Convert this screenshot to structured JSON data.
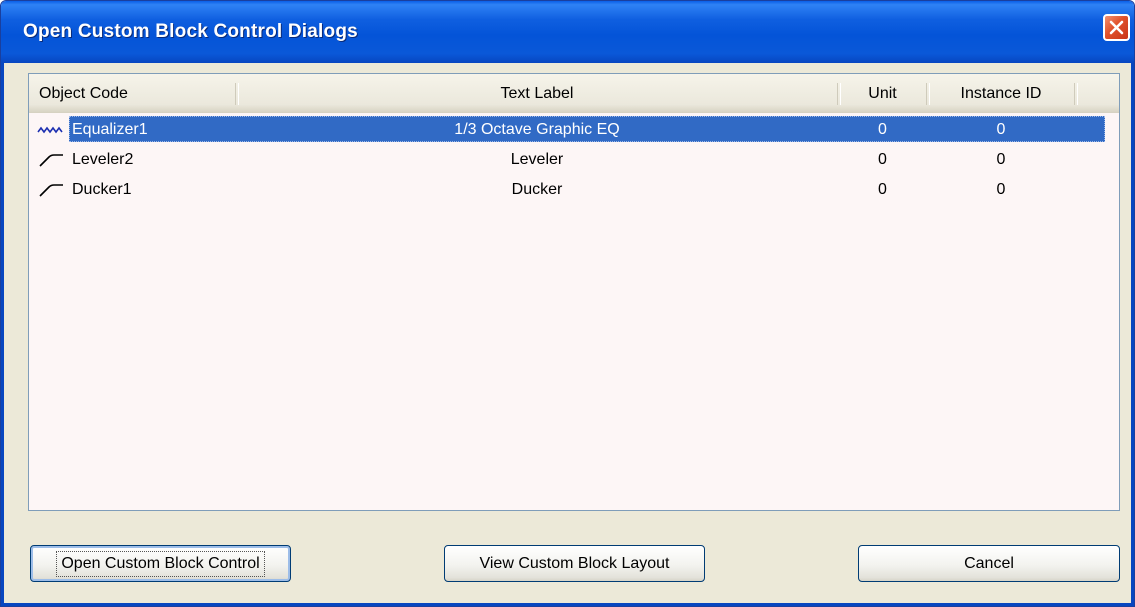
{
  "window": {
    "title": "Open Custom Block Control Dialogs",
    "close_icon": "close-x-icon"
  },
  "list": {
    "columns": [
      "Object Code",
      "Text Label",
      "Unit",
      "Instance ID"
    ],
    "rows": [
      {
        "icon": "wave-icon",
        "object_code": "Equalizer1",
        "text_label": "1/3 Octave Graphic EQ",
        "unit": "0",
        "instance_id": "0",
        "selected": true
      },
      {
        "icon": "ramp-icon",
        "object_code": "Leveler2",
        "text_label": "Leveler",
        "unit": "0",
        "instance_id": "0",
        "selected": false
      },
      {
        "icon": "ramp-icon",
        "object_code": "Ducker1",
        "text_label": "Ducker",
        "unit": "0",
        "instance_id": "0",
        "selected": false
      }
    ]
  },
  "buttons": {
    "open": "Open Custom Block Control",
    "view": "View Custom Block Layout",
    "cancel": "Cancel"
  },
  "colors": {
    "titlebar": "#0454d8",
    "selection": "#316ac5",
    "list_background": "#fdf6f6",
    "dialog_background": "#ece9d8"
  }
}
